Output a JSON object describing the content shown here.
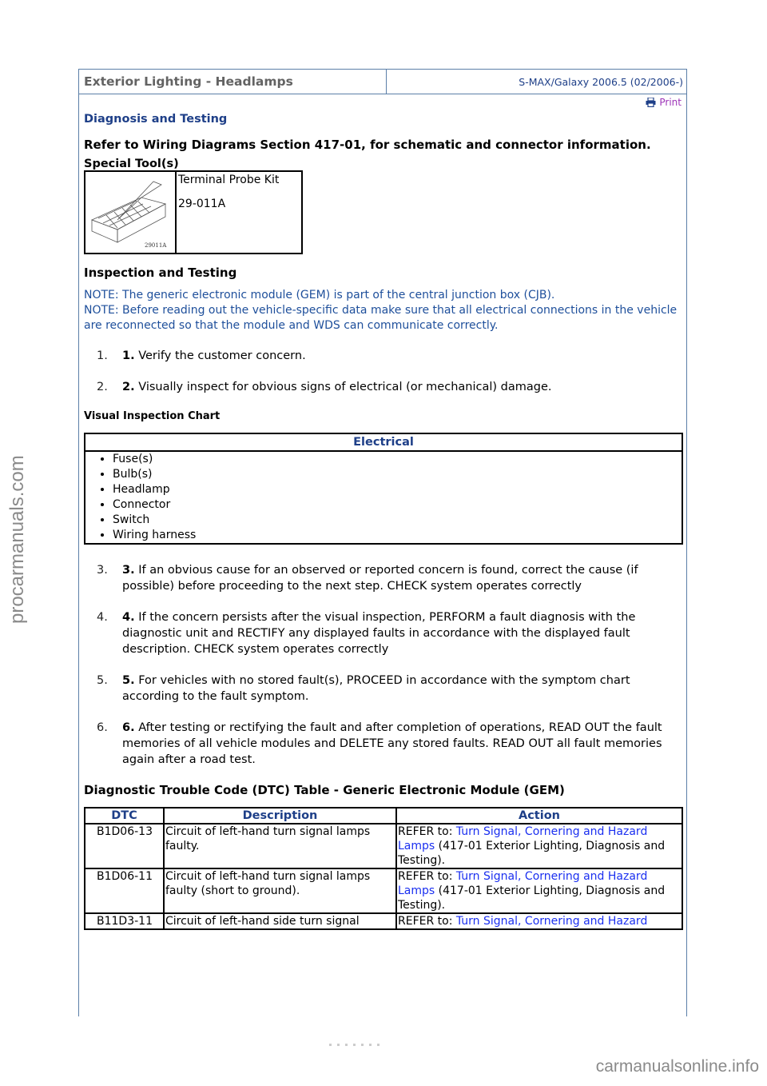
{
  "header": {
    "title": "Exterior Lighting - Headlamps",
    "model": "S-MAX/Galaxy 2006.5 (02/2006-)"
  },
  "print": {
    "label": "Print",
    "icon": "printer-icon"
  },
  "section_title": "Diagnosis and Testing",
  "refer_text": "Refer to Wiring Diagrams Section 417-01, for schematic and connector information.",
  "special_tools": {
    "heading": "Special Tool(s)",
    "tool": {
      "name": "Terminal Probe Kit",
      "number": "29-011A",
      "image_label": "29011A"
    }
  },
  "inspection": {
    "heading": "Inspection and Testing",
    "notes": [
      "NOTE: The generic electronic module (GEM) is part of the central junction box (CJB).",
      "NOTE: Before reading out the vehicle-specific data make sure that all electrical connections in the vehicle are reconnected so that the module and WDS can communicate correctly."
    ],
    "steps_a": [
      {
        "num": "1.",
        "bold": "1.",
        "text": " Verify the customer concern."
      },
      {
        "num": "2.",
        "bold": "2.",
        "text": " Visually inspect for obvious signs of electrical (or mechanical) damage."
      }
    ],
    "visual_chart": {
      "heading": "Visual Inspection Chart",
      "column": "Electrical",
      "items": [
        "Fuse(s)",
        "Bulb(s)",
        "Headlamp",
        "Connector",
        "Switch",
        "Wiring harness"
      ]
    },
    "steps_b": [
      {
        "num": "3.",
        "bold": "3.",
        "text": " If an obvious cause for an observed or reported concern is found, correct the cause (if possible) before proceeding to the next step. CHECK system operates correctly"
      },
      {
        "num": "4.",
        "bold": "4.",
        "text": " If the concern persists after the visual inspection, PERFORM a fault diagnosis with the diagnostic unit and RECTIFY any displayed faults in accordance with the displayed fault description. CHECK system operates correctly"
      },
      {
        "num": "5.",
        "bold": "5.",
        "text": " For vehicles with no stored fault(s), PROCEED in accordance with the symptom chart according to the fault symptom."
      },
      {
        "num": "6.",
        "bold": "6.",
        "text": " After testing or rectifying the fault and after completion of operations, READ OUT the fault memories of all vehicle modules and DELETE any stored faults. READ OUT all fault memories again after a road test."
      }
    ]
  },
  "dtc_table": {
    "heading": "Diagnostic Trouble Code (DTC) Table - Generic Electronic Module (GEM)",
    "columns": [
      "DTC",
      "Description",
      "Action"
    ],
    "rows": [
      {
        "code": "B1D06-13",
        "description": "Circuit of left-hand turn signal lamps faulty.",
        "action_prefix": "REFER to: ",
        "action_link": "Turn Signal, Cornering and Hazard Lamps",
        "action_suffix": " (417-01 Exterior Lighting, Diagnosis and Testing)."
      },
      {
        "code": "B1D06-11",
        "description": "Circuit of left-hand turn signal lamps faulty (short to ground).",
        "action_prefix": "REFER to: ",
        "action_link": "Turn Signal, Cornering and Hazard Lamps",
        "action_suffix": " (417-01 Exterior Lighting, Diagnosis and Testing)."
      },
      {
        "code": "B11D3-11",
        "description": "Circuit of left-hand side turn signal",
        "action_prefix": "REFER to: ",
        "action_link": "Turn Signal, Cornering and Hazard",
        "action_suffix": ""
      }
    ]
  },
  "watermarks": {
    "left": "procarmanuals.com",
    "bottom_right": "carmanualsonline.info"
  }
}
